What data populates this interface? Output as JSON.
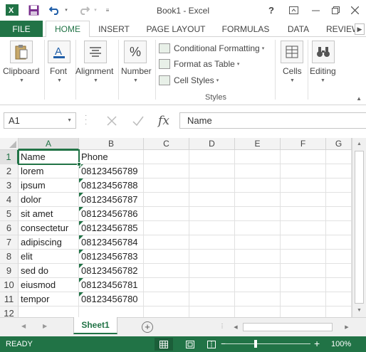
{
  "window": {
    "title": "Book1 - Excel",
    "help_icon": "?",
    "buttons": [
      "ribbon-display-icon",
      "minimize-icon",
      "restore-icon",
      "close-icon"
    ]
  },
  "quick_access": {
    "icons": [
      "excel-logo-icon",
      "save-icon",
      "undo-icon",
      "redo-icon",
      "customize-qat-icon"
    ]
  },
  "ribbon_tabs": {
    "file": "FILE",
    "tabs": [
      "HOME",
      "INSERT",
      "PAGE LAYOUT",
      "FORMULAS",
      "DATA",
      "REVIEW"
    ],
    "active": "HOME"
  },
  "ribbon": {
    "clipboard": "Clipboard",
    "font": "Font",
    "alignment": "Alignment",
    "number": "Number",
    "conditional_formatting": "Conditional Formatting",
    "format_as_table": "Format as Table",
    "cell_styles": "Cell Styles",
    "styles_group": "Styles",
    "cells": "Cells",
    "editing": "Editing"
  },
  "formula_bar": {
    "name_box": "A1",
    "formula": "Name",
    "fx": "fx"
  },
  "grid": {
    "columns": [
      "A",
      "B",
      "C",
      "D",
      "E",
      "F",
      "G"
    ],
    "rows": [
      "1",
      "2",
      "3",
      "4",
      "5",
      "6",
      "7",
      "8",
      "9",
      "10",
      "11",
      "12"
    ],
    "cells": [
      [
        "Name",
        "Phone"
      ],
      [
        "lorem",
        "08123456789"
      ],
      [
        "ipsum",
        "08123456788"
      ],
      [
        "dolor",
        "08123456787"
      ],
      [
        "sit amet",
        "08123456786"
      ],
      [
        "consectetur",
        "08123456785"
      ],
      [
        "adipiscing",
        "08123456784"
      ],
      [
        "elit",
        "08123456783"
      ],
      [
        "sed do",
        "08123456782"
      ],
      [
        "eiusmod",
        "08123456781"
      ],
      [
        "tempor",
        "08123456780"
      ]
    ]
  },
  "sheets": {
    "tabs": [
      "Sheet1"
    ],
    "active": "Sheet1",
    "add": "+"
  },
  "status": {
    "text": "READY",
    "zoom": "100%",
    "zoom_minus": "−",
    "zoom_plus": "+"
  },
  "colors": {
    "accent": "#217346",
    "error_triangle": "#217346"
  }
}
